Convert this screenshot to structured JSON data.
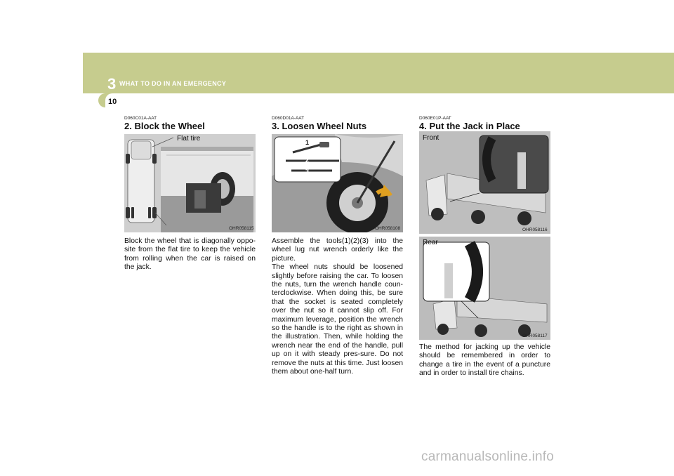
{
  "header": {
    "chapter_number": "3",
    "chapter_title": "WHAT TO DO IN AN EMERGENCY",
    "page_number": "10"
  },
  "sections": [
    {
      "code": "D060C01A-AAT",
      "title": "2. Block the Wheel",
      "figure_label": "Flat tire",
      "figure_id": "OHR058115",
      "body": "Block the wheel that is diagonally oppo-site from the flat tire to keep the vehicle from rolling when the car is raised on the jack."
    },
    {
      "code": "D060D01A-AAT",
      "title": "3. Loosen Wheel Nuts",
      "figure_id": "OHR058108",
      "tool_numbers": [
        "1",
        "2",
        "3"
      ],
      "body": "Assemble the tools(1)(2)(3) into the wheel lug nut wrench orderly like the picture.\nThe wheel nuts should be loosened slightly before raising the car. To loosen the nuts, turn the wrench handle coun-terclockwise. When doing this, be sure that the socket is seated completely over the nut so it cannot slip off. For maximum leverage, position the wrench so the handle is to the right as shown in the illustration. Then, while holding the wrench near the end of the handle, pull up on it with steady pres-sure.  Do not remove the nuts at this time. Just loosen them about one-half turn."
    },
    {
      "code": "D060E01P-AAT",
      "title": "4. Put the Jack in Place",
      "figure_front_label": "Front",
      "figure_front_id": "OHR058116",
      "figure_rear_label": "Rear",
      "figure_rear_id": "OHR058117",
      "body": "The method for jacking up the vehicle should be remembered in order to change a tire in the event of a puncture and in order to install tire chains."
    }
  ],
  "watermark": "carmanualsonline.info"
}
